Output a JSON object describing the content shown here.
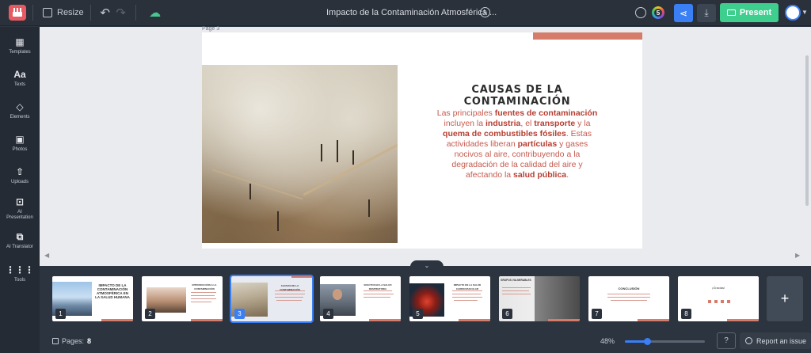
{
  "topbar": {
    "resize_label": "Resize",
    "document_title": "Impacto de la Contaminación Atmosférica ...",
    "ai_badge": "5",
    "present_label": "Present"
  },
  "sidebar": {
    "items": [
      {
        "label": "Templates",
        "icon": "templates-icon"
      },
      {
        "label": "Texts",
        "icon": "texts-icon"
      },
      {
        "label": "Elements",
        "icon": "elements-icon"
      },
      {
        "label": "Photos",
        "icon": "photos-icon"
      },
      {
        "label": "Uploads",
        "icon": "uploads-icon"
      },
      {
        "label": "AI Presentation",
        "icon": "ai-presentation-icon"
      },
      {
        "label": "AI Translator",
        "icon": "ai-translator-icon"
      },
      {
        "label": "Tools",
        "icon": "tools-icon"
      }
    ]
  },
  "canvas": {
    "page_label": "Page 3",
    "slide": {
      "title": "CAUSAS DE LA CONTAMINACIÓN",
      "body_parts": [
        {
          "text": "Las principales ",
          "bold": false
        },
        {
          "text": "fuentes de contaminación",
          "bold": true
        },
        {
          "text": " incluyen la ",
          "bold": false
        },
        {
          "text": "industria",
          "bold": true
        },
        {
          "text": ", el ",
          "bold": false
        },
        {
          "text": "transporte",
          "bold": true
        },
        {
          "text": " y la ",
          "bold": false
        },
        {
          "text": "quema de combustibles fósiles",
          "bold": true
        },
        {
          "text": ". Estas actividades liberan ",
          "bold": false
        },
        {
          "text": "partículas",
          "bold": true
        },
        {
          "text": " y gases nocivos al aire, contribuyendo a la degradación de la calidad del aire y afectando la ",
          "bold": false
        },
        {
          "text": "salud pública",
          "bold": true
        },
        {
          "text": ".",
          "bold": false
        }
      ]
    }
  },
  "thumbnails": [
    {
      "num": "1",
      "title": "IMPACTO DE LA CONTAMINACIÓN ATMOSFÉRICA EN LA SALUD HUMANA",
      "active": false
    },
    {
      "num": "2",
      "title": "INTRODUCCIÓN A LA CONTAMINACIÓN",
      "active": false
    },
    {
      "num": "3",
      "title": "CAUSAS DE LA CONTAMINACIÓN",
      "active": true
    },
    {
      "num": "4",
      "title": "EFECTOS EN LA SALUD RESPIRATORIA",
      "active": false
    },
    {
      "num": "5",
      "title": "IMPACTO EN LA SALUD CARDIOVASCULAR",
      "active": false
    },
    {
      "num": "6",
      "title": "GRUPOS VULNERABLES",
      "active": false
    },
    {
      "num": "7",
      "title": "CONCLUSIÓN",
      "active": false
    },
    {
      "num": "8",
      "title": "¡Gracias!",
      "active": false
    }
  ],
  "add_page_label": "+",
  "bottombar": {
    "pages_label": "Pages:",
    "pages_count": "8",
    "zoom": "48%",
    "zoom_fraction": 0.28,
    "help_label": "?",
    "report_label": "Report an issue"
  }
}
